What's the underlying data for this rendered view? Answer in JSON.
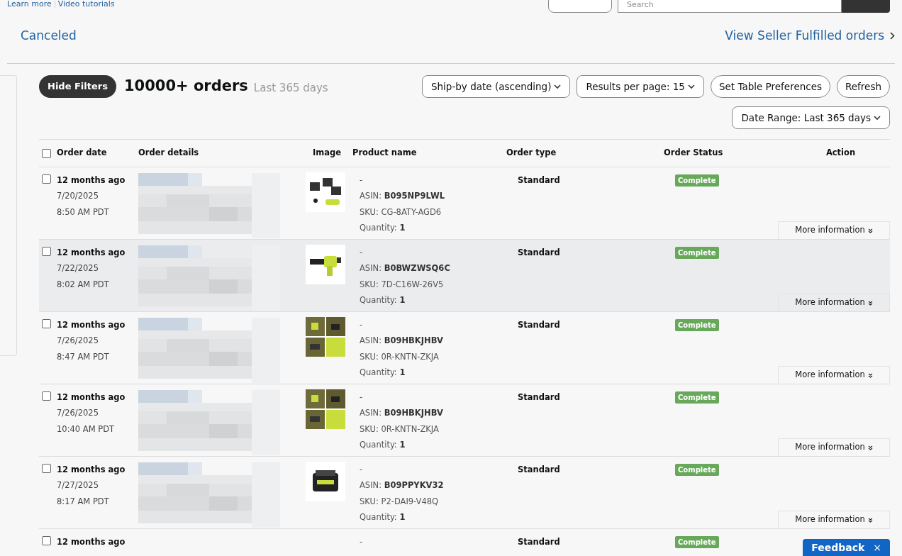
{
  "top_links": [
    "Learn more",
    "Video tutorials"
  ],
  "search": {
    "placeholder": "Search"
  },
  "tabs": [
    {
      "label": "Canceled",
      "selected": false
    }
  ],
  "seller_link": "View Seller Fulfilled orders",
  "toolbar": {
    "hide_filters": "Hide Filters",
    "count": "10000+ orders",
    "period": "Last 365 days",
    "buttons": [
      {
        "label": "Ship-by date (ascending)",
        "kind": "dropdown"
      },
      {
        "label": "Results per page: 15",
        "kind": "dropdown"
      },
      {
        "label": "Set Table Preferences",
        "kind": "button"
      },
      {
        "label": "Refresh",
        "kind": "button"
      }
    ],
    "date_range": "Date Range: Last 365 days"
  },
  "table": {
    "select_all_checked": false,
    "columns": [
      "Order date",
      "Order details",
      "Image",
      "Product name",
      "Order type",
      "Order Status",
      "Action"
    ],
    "rows": [
      {
        "checked": false,
        "selected": false,
        "ago": "12 months ago",
        "date": "7/20/2025",
        "time": "8:50 AM PDT",
        "product": "-",
        "asin_label": "ASIN:",
        "asin": "B095NP9LWL",
        "sku": "SKU: CG-8ATY-AGD6",
        "qty_label": "Quantity:",
        "qty": "1",
        "order_type": "Standard",
        "status": "Complete",
        "action": "More information"
      },
      {
        "checked": false,
        "selected": true,
        "ago": "12 months ago",
        "date": "7/22/2025",
        "time": "8:02 AM PDT",
        "product": "-",
        "asin_label": "ASIN:",
        "asin": "B0BWZWSQ6C",
        "sku": "SKU: 7D-C16W-26V5",
        "qty_label": "Quantity:",
        "qty": "1",
        "order_type": "Standard",
        "status": "Complete",
        "action": "More information"
      },
      {
        "checked": false,
        "selected": false,
        "ago": "12 months ago",
        "date": "7/26/2025",
        "time": "8:47 AM PDT",
        "product": "-",
        "asin_label": "ASIN:",
        "asin": "B09HBKJHBV",
        "sku": "SKU: 0R-KNTN-ZKJA",
        "qty_label": "Quantity:",
        "qty": "1",
        "order_type": "Standard",
        "status": "Complete",
        "action": "More information"
      },
      {
        "checked": false,
        "selected": false,
        "ago": "12 months ago",
        "date": "7/26/2025",
        "time": "10:40 AM PDT",
        "product": "-",
        "asin_label": "ASIN:",
        "asin": "B09HBKJHBV",
        "sku": "SKU: 0R-KNTN-ZKJA",
        "qty_label": "Quantity:",
        "qty": "1",
        "order_type": "Standard",
        "status": "Complete",
        "action": "More information"
      },
      {
        "checked": false,
        "selected": false,
        "ago": "12 months ago",
        "date": "7/27/2025",
        "time": "8:17 AM PDT",
        "product": "-",
        "asin_label": "ASIN:",
        "asin": "B09PPYKV32",
        "sku": "SKU: P2-DAI9-V48Q",
        "qty_label": "Quantity:",
        "qty": "1",
        "order_type": "Standard",
        "status": "Complete",
        "action": "More information"
      },
      {
        "checked": false,
        "selected": false,
        "ago": "12 months ago",
        "product": "-",
        "order_type": "Standard",
        "status": "Complete"
      }
    ]
  },
  "feedback": {
    "label": "Feedback",
    "close": "×"
  }
}
